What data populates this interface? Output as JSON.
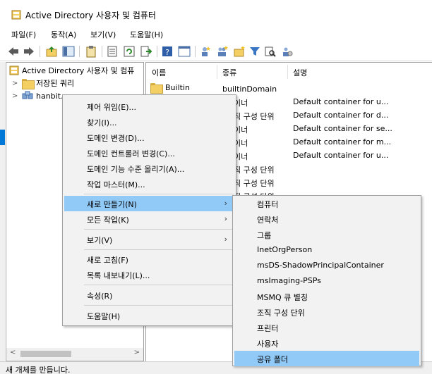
{
  "window": {
    "title": "Active Directory 사용자 및 컴퓨터"
  },
  "menubar": [
    {
      "label": "파일(F)"
    },
    {
      "label": "동작(A)"
    },
    {
      "label": "보기(V)"
    },
    {
      "label": "도움말(H)"
    }
  ],
  "tree": {
    "root": "Active Directory 사용자 및 컴퓨",
    "saved_queries": "저장된 쿼리",
    "domain": "hanbit.com"
  },
  "list": {
    "columns": [
      "이름",
      "종류",
      "설명"
    ],
    "rows": [
      {
        "name": "Builtin",
        "type": "builtinDomain",
        "desc": ""
      },
      {
        "name": "",
        "type": "이너",
        "desc": "Default container for u..."
      },
      {
        "name": "",
        "type": "직 구성 단위",
        "desc": "Default container for d..."
      },
      {
        "name": "",
        "type": "이너",
        "desc": "Default container for se..."
      },
      {
        "name": "",
        "type": "이너",
        "desc": "Default container for m..."
      },
      {
        "name": "",
        "type": "이너",
        "desc": "Default container for u..."
      },
      {
        "name": "",
        "type": "직 구성 단위",
        "desc": ""
      },
      {
        "name": "",
        "type": "직 구성 단위",
        "desc": ""
      },
      {
        "name": "",
        "type": "직 구성 단위",
        "desc": ""
      }
    ]
  },
  "context_menu": {
    "items": [
      {
        "label": "제어 위임(E)..."
      },
      {
        "label": "찾기(I)..."
      },
      {
        "label": "도메인 변경(D)..."
      },
      {
        "label": "도메인 컨트롤러 변경(C)..."
      },
      {
        "label": "도메인 기능 수준 올리기(A)..."
      },
      {
        "label": "작업 마스터(M)..."
      },
      {
        "label": "새로 만들기(N)"
      },
      {
        "label": "모든 작업(K)"
      },
      {
        "label": "보기(V)"
      },
      {
        "label": "새로 고침(F)"
      },
      {
        "label": "목록 내보내기(L)..."
      },
      {
        "label": "속성(R)"
      },
      {
        "label": "도움말(H)"
      }
    ],
    "arrow": "›"
  },
  "submenu": {
    "items": [
      {
        "label": "컴퓨터"
      },
      {
        "label": "연락처"
      },
      {
        "label": "그룹"
      },
      {
        "label": "InetOrgPerson"
      },
      {
        "label": "msDS-ShadowPrincipalContainer"
      },
      {
        "label": "msImaging-PSPs"
      },
      {
        "label": "MSMQ 큐 별칭"
      },
      {
        "label": "조직 구성 단위"
      },
      {
        "label": "프린터"
      },
      {
        "label": "사용자"
      },
      {
        "label": "공유 폴더"
      }
    ]
  },
  "statusbar": {
    "text": "새 개체를 만듭니다."
  },
  "colors": {
    "highlight": "#91c9f7",
    "menu_bg": "#f2f2f2",
    "accent": "#0078d7"
  }
}
